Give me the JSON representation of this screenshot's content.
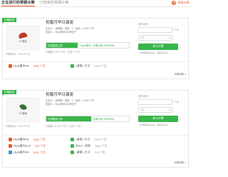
{
  "tabs": {
    "active": "正在进行的常银众筹",
    "inactive": "已结束的常银众筹"
  },
  "logo": {
    "mark": "常",
    "text": "常银众筹"
  },
  "cards": [
    {
      "ribbon": "众筹接收",
      "thumb_label": "1个膜位",
      "date": "众筹时间：2013.03.19",
      "title": "祝魔月早日康复",
      "meta1": "生效人：嘉颜粥  ·  类型：1  ·  目标：5,000 个币",
      "meta2": "发起人：My★魔月#★伴侣子",
      "progress_pct": 38,
      "progress_text": "礼物数量已到：",
      "progress_extra": "My★魔月☆手筹礼物 (9999555)",
      "status": "已筹集 0,000 个币 · 已送 0 个币",
      "side_label": "您的出资：",
      "side_input": "",
      "side_unit": "个币",
      "side_select": "100",
      "side_button": "参与众筹",
      "side_note": "* 礼物数量达到后，发起者可得",
      "stats": [
        {
          "icon": "user-icon",
          "name": "My★魔月#★",
          "value": "4000 个币"
        },
        {
          "icon": "user-icon",
          "name": "♪紫薇☆日子",
          "value": "1000 个币"
        }
      ],
      "details": "众筹详情 >"
    },
    {
      "ribbon": "众筹接收",
      "thumb_label": "1个膜兔",
      "date": "众筹时间：2013.03.19",
      "title": "祝魔月早日康复",
      "meta1": "生效人：嘉颜粥  ·  类型：1  ·  目标：5,000 个币",
      "meta2": "发起人：My★魔月#★伴侣子",
      "progress_pct": 54,
      "progress_text": "礼物数量已到：",
      "progress_extra": "My★魔月☆手筹礼物 (9999555)",
      "status": "已筹集 10,000 个币 · 已送 0 个币",
      "side_label": "您的出资：",
      "side_input": "",
      "side_unit": "个币",
      "side_select": "100",
      "side_button": "参与众筹",
      "side_note": "* 礼物数量达到后，发起者可得",
      "stats": [
        {
          "icon": "user-icon",
          "name": "My★魔月#★",
          "value": "4000 个币"
        },
        {
          "icon": "user-icon",
          "name": "♪紫薇☆日子",
          "value": "2000 个币"
        },
        {
          "icon": "user-icon",
          "name": "My★魔月★Z4",
          "value": "404 个币"
        },
        {
          "icon": "user-icon",
          "name": "迈Dor☆家葡",
          "value": "2500 个币"
        },
        {
          "icon": "user-icon",
          "name": "My★魔月★4",
          "value": "6000 个币"
        },
        {
          "icon": "user-icon",
          "name": "♪紫薇☆日子",
          "value": "700 个币"
        }
      ],
      "details": "众筹详情 >"
    }
  ],
  "colors": {
    "accent_green": "#39b54a",
    "accent_orange": "#e85c2c"
  }
}
